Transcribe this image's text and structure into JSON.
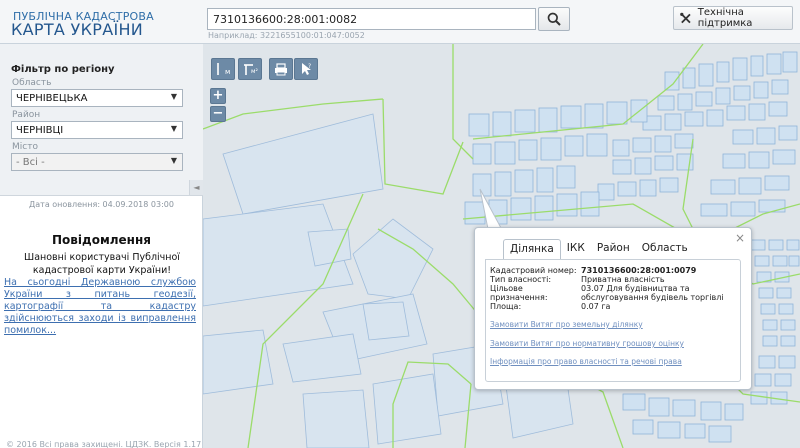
{
  "header": {
    "brand_top": "ПУБЛІЧНА КАДАСТРОВА",
    "brand_main": "КАРТА УКРАЇНИ",
    "search_value": "7310136600:28:001:0082",
    "search_hint": "Наприклад: 3221655100:01:047:0052",
    "support_label": "Технічна підтримка",
    "icons": {
      "search": "search-icon",
      "support": "tools-icon"
    }
  },
  "filter": {
    "title": "Фільтр по регіону",
    "region_label": "Область",
    "region_value": "ЧЕРНІВЕЦЬКА",
    "district_label": "Район",
    "district_value": "ЧЕРНІВЦІ",
    "city_label": "Місто",
    "city_value": "- Всі -",
    "collapse_glyph": "◄"
  },
  "sidebar": {
    "update_date": "Дата оновлення: 04.09.2018 03:00",
    "notice_title": "Повідомлення",
    "notice_greeting": "Шановні користувачі Публічної кадастрової карти України!",
    "notice_link": "На сьогодні Державною службою України з питань геодезії, картографії та кадастру здійснюються заходи із виправлення помилок...",
    "footer": "© 2016 Всі права захищені. ЦДЗК. Версія 1.17"
  },
  "map_tools": {
    "ruler_label": "м",
    "area_label": "м²",
    "zoom_in": "+",
    "zoom_out": "−",
    "icons": [
      "ruler-icon",
      "area-measure-icon",
      "print-icon",
      "pointer-info-icon"
    ]
  },
  "popup": {
    "close": "×",
    "tabs": [
      "Ділянка",
      "ІКК",
      "Район",
      "Область"
    ],
    "active_tab": "Ділянка",
    "fields": [
      {
        "key": "Кадастровий номер:",
        "value": "7310136600:28:001:0079"
      },
      {
        "key": "Тип власності:",
        "value": "Приватна власність"
      },
      {
        "key": "Цільове призначення:",
        "value": "03.07 Для будівництва та обслуговування будівель торгівлі"
      },
      {
        "key": "Площа:",
        "value": "0.07 га"
      }
    ],
    "links": [
      "Замовити Витяг про земельну ділянку",
      "Замовити Витяг про нормативну грошову оцінку",
      "Інформація про право власності та речові права"
    ]
  },
  "colors": {
    "map_background": "#dfe5ea",
    "parcel_fill": "#cfe1f1",
    "parcel_stroke": "#8fb4d9",
    "boundary_green": "#9bdc6a",
    "tool_button": "#6d8aa6",
    "brand_blue": "#24578e",
    "link_blue": "#3d6fb0"
  }
}
